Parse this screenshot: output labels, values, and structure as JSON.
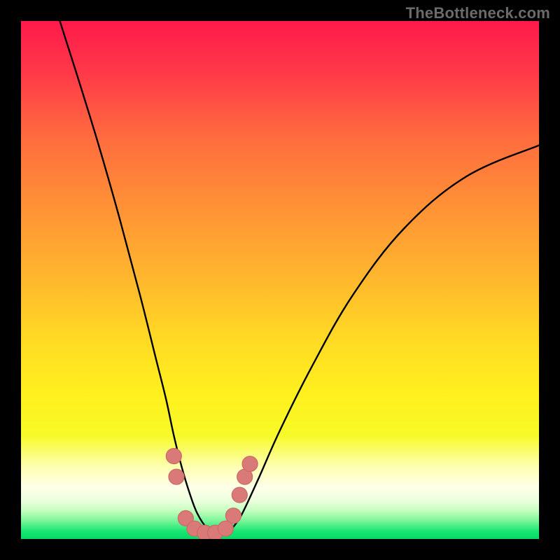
{
  "watermark": {
    "text": "TheBottleneck.com"
  },
  "colors": {
    "frame": "#000000",
    "curve": "#000000",
    "marker_fill": "#d97a78",
    "marker_stroke": "#c96a66",
    "gradient_stops": [
      {
        "offset": 0.0,
        "color": "#ff1a4a"
      },
      {
        "offset": 0.1,
        "color": "#ff3949"
      },
      {
        "offset": 0.22,
        "color": "#ff6a3f"
      },
      {
        "offset": 0.35,
        "color": "#ff8f36"
      },
      {
        "offset": 0.5,
        "color": "#ffb82d"
      },
      {
        "offset": 0.62,
        "color": "#ffdb24"
      },
      {
        "offset": 0.72,
        "color": "#fff01e"
      },
      {
        "offset": 0.8,
        "color": "#f7fa28"
      },
      {
        "offset": 0.86,
        "color": "#fdffb0"
      },
      {
        "offset": 0.9,
        "color": "#ffffe8"
      },
      {
        "offset": 0.925,
        "color": "#ecffdf"
      },
      {
        "offset": 0.945,
        "color": "#c6ffc0"
      },
      {
        "offset": 0.965,
        "color": "#7af598"
      },
      {
        "offset": 0.985,
        "color": "#18e673"
      },
      {
        "offset": 1.0,
        "color": "#07d865"
      }
    ]
  },
  "chart_data": {
    "type": "line",
    "title": "",
    "xlabel": "",
    "ylabel": "",
    "xlim": [
      0,
      1
    ],
    "ylim": [
      0,
      1
    ],
    "note": "V-shaped bottleneck curve. x is normalized horizontal position; y is bottleneck percentage (1 = 100% at top, 0 = 0% at bottom green band). Minimum ≈ 0 near x ≈ 0.33–0.40.",
    "series": [
      {
        "name": "bottleneck-curve",
        "x": [
          0.075,
          0.11,
          0.15,
          0.19,
          0.23,
          0.26,
          0.28,
          0.295,
          0.31,
          0.325,
          0.34,
          0.36,
          0.38,
          0.4,
          0.415,
          0.43,
          0.46,
          0.5,
          0.56,
          0.64,
          0.74,
          0.86,
          1.0
        ],
        "y": [
          1.0,
          0.89,
          0.76,
          0.62,
          0.47,
          0.35,
          0.27,
          0.2,
          0.14,
          0.09,
          0.05,
          0.02,
          0.01,
          0.015,
          0.03,
          0.055,
          0.12,
          0.21,
          0.33,
          0.47,
          0.6,
          0.7,
          0.76
        ]
      }
    ],
    "marker_points_note": "Pink rounded dots along the valley of the curve.",
    "marker_points": [
      {
        "x": 0.295,
        "y": 0.16
      },
      {
        "x": 0.3,
        "y": 0.12
      },
      {
        "x": 0.318,
        "y": 0.04
      },
      {
        "x": 0.335,
        "y": 0.02
      },
      {
        "x": 0.355,
        "y": 0.012
      },
      {
        "x": 0.375,
        "y": 0.012
      },
      {
        "x": 0.395,
        "y": 0.02
      },
      {
        "x": 0.41,
        "y": 0.045
      },
      {
        "x": 0.422,
        "y": 0.085
      },
      {
        "x": 0.432,
        "y": 0.12
      },
      {
        "x": 0.442,
        "y": 0.145
      }
    ]
  }
}
